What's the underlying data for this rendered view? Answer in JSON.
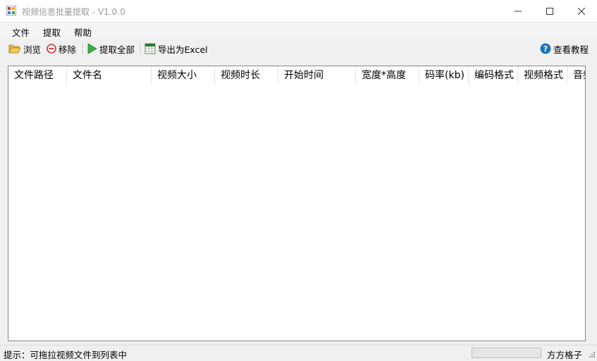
{
  "window": {
    "title": "视频信息批量提取 - V1.0.0"
  },
  "menu": {
    "items": [
      {
        "label": "文件"
      },
      {
        "label": "提取"
      },
      {
        "label": "帮助"
      }
    ]
  },
  "toolbar": {
    "browse_label": "浏览",
    "remove_label": "移除",
    "extract_all_label": "提取全部",
    "export_excel_label": "导出为Excel",
    "tutorial_label": "查看教程"
  },
  "table": {
    "columns": [
      {
        "label": "文件路径"
      },
      {
        "label": "文件名"
      },
      {
        "label": "视频大小"
      },
      {
        "label": "视频时长"
      },
      {
        "label": "开始时间"
      },
      {
        "label": "宽度*高度"
      },
      {
        "label": "码率(kb)"
      },
      {
        "label": "编码格式"
      },
      {
        "label": "视频格式"
      },
      {
        "label": "音频"
      }
    ],
    "rows": []
  },
  "status": {
    "hint": "提示：可拖拉视频文件到列表中",
    "progress_fraction": 0,
    "brand": "方方格子"
  },
  "colors": {
    "window_bg": "#f0f0f0",
    "list_border": "#828790",
    "progress_fill": "#06b025",
    "help_icon": "#1e73be"
  }
}
